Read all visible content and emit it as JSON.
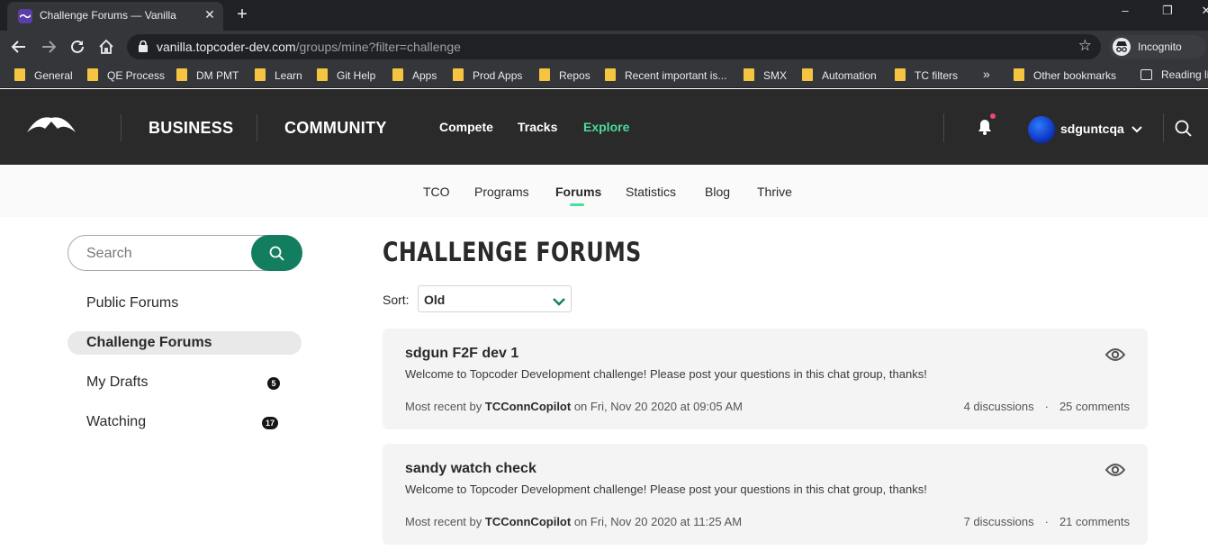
{
  "browser": {
    "tab_title": "Challenge Forums — Vanilla",
    "url_host": "vanilla.topcoder-dev.com",
    "url_path": "/groups/mine?filter=challenge",
    "incognito_label": "Incognito",
    "bookmarks": [
      "General",
      "QE Process",
      "DM PMT",
      "Learn",
      "Git Help",
      "Apps",
      "Prod Apps",
      "Repos",
      "Recent important is...",
      "SMX",
      "Automation",
      "TC filters"
    ],
    "more_label": "»",
    "other_bookmarks": "Other bookmarks",
    "reading_list": "Reading list"
  },
  "header": {
    "business": "BUSINESS",
    "community": "COMMUNITY",
    "nav": [
      "Compete",
      "Tracks",
      "Explore"
    ],
    "username": "sdguntcqa",
    "accent_color": "#4bdb9b"
  },
  "subnav": {
    "items": [
      "TCO",
      "Programs",
      "Forums",
      "Statistics",
      "Blog",
      "Thrive"
    ],
    "active": "Forums"
  },
  "sidebar": {
    "search_placeholder": "Search",
    "items": [
      {
        "label": "Public Forums",
        "count": null
      },
      {
        "label": "Challenge Forums",
        "count": null
      },
      {
        "label": "My Drafts",
        "count": "5"
      },
      {
        "label": "Watching",
        "count": "17"
      }
    ],
    "active": "Challenge Forums",
    "search_button_color": "#137d60"
  },
  "main": {
    "title": "CHALLENGE FORUMS",
    "sort_label": "Sort:",
    "sort_value": "Old",
    "cards": [
      {
        "title": "sdgun F2F dev 1",
        "description": "Welcome to Topcoder Development challenge! Please post your questions in this chat group, thanks!",
        "meta_prefix": "Most recent by",
        "author": "TCConnCopilot",
        "meta_suffix": "on Fri, Nov 20 2020 at 09:05 AM",
        "discussions": "4 discussions",
        "comments": "25 comments"
      },
      {
        "title": "sandy watch check",
        "description": "Welcome to Topcoder Development challenge! Please post your questions in this chat group, thanks!",
        "meta_prefix": "Most recent by",
        "author": "TCConnCopilot",
        "meta_suffix": "on Fri, Nov 20 2020 at 11:25 AM",
        "discussions": "7 discussions",
        "comments": "21 comments"
      }
    ]
  }
}
